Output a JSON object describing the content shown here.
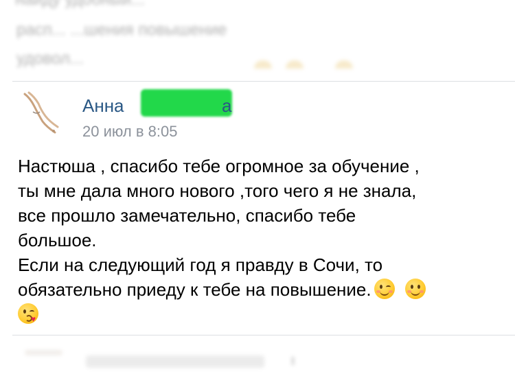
{
  "previous_post": {
    "lines": [
      "найду удобный...",
      "расп... ...шения повышение",
      "удовол..."
    ]
  },
  "post": {
    "author_first_name": "Анна",
    "author_last_name_tail": "а",
    "date": "20 июл в 8:05",
    "text_lines": [
      "Настюша , спасибо тебе огромное за обучение ,",
      "ты мне дала много нового ,того чего я не знала,",
      "все прошло замечательно, спасибо тебе",
      "большое.",
      "Если на следующий год я правду в Сочи, то",
      "обязательно приеду к тебе на повышение."
    ],
    "emojis": [
      "winking-face-emoji",
      "smiling-face-emoji",
      "kissing-face-emoji"
    ]
  },
  "colors": {
    "name_link": "#2a5885",
    "date_gray": "#8c929b",
    "divider": "#dcdfe3",
    "censor_green": "#22d84a"
  }
}
